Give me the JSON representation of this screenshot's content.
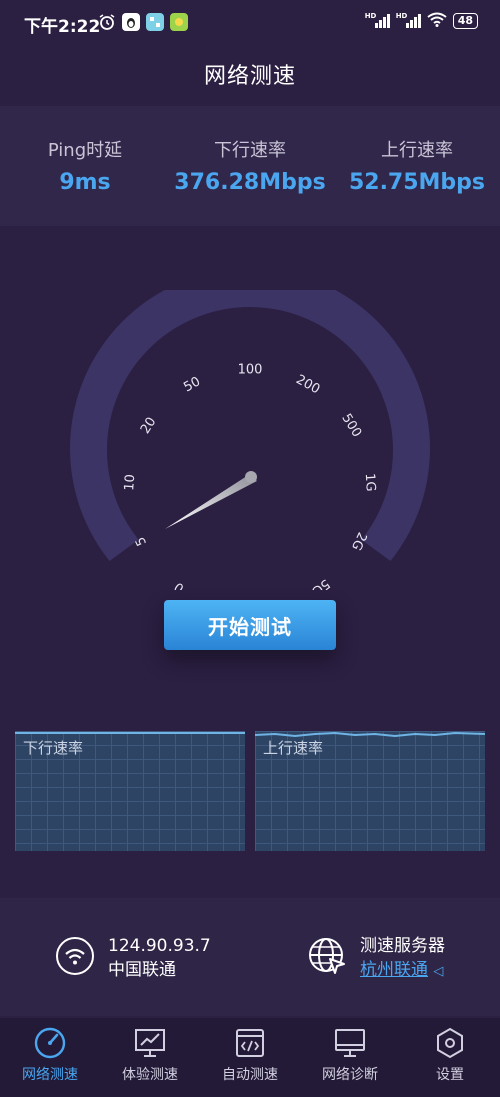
{
  "status": {
    "time": "下午2:22",
    "battery": "48",
    "network_badge": "HD"
  },
  "header": {
    "title": "网络测速"
  },
  "stats": {
    "ping": {
      "label": "Ping时延",
      "value": "9ms"
    },
    "download": {
      "label": "下行速率",
      "value": "376.28Mbps"
    },
    "upload": {
      "label": "上行速率",
      "value": "52.75Mbps"
    }
  },
  "gauge": {
    "ticks": [
      "0",
      "5",
      "10",
      "20",
      "50",
      "100",
      "200",
      "500",
      "1G",
      "2G",
      "5G"
    ],
    "needle_value": "5"
  },
  "start_button": {
    "label": "开始测试"
  },
  "graphs": {
    "download_label": "下行速率",
    "upload_label": "上行速率"
  },
  "network_info": {
    "ip": "124.90.93.7",
    "isp": "中国联通",
    "server_label": "测速服务器",
    "server_name": "杭州联通"
  },
  "nav": [
    {
      "label": "网络测速",
      "icon": "speedometer-icon",
      "active": true
    },
    {
      "label": "体验测速",
      "icon": "chart-monitor-icon",
      "active": false
    },
    {
      "label": "自动测速",
      "icon": "code-window-icon",
      "active": false
    },
    {
      "label": "网络诊断",
      "icon": "monitor-icon",
      "active": false
    },
    {
      "label": "设置",
      "icon": "hexagon-settings-icon",
      "active": false
    }
  ],
  "colors": {
    "background": "#2b1f42",
    "accent": "#4aa6ef",
    "button_top": "#4eb4f4",
    "button_bottom": "#2a84d6"
  }
}
